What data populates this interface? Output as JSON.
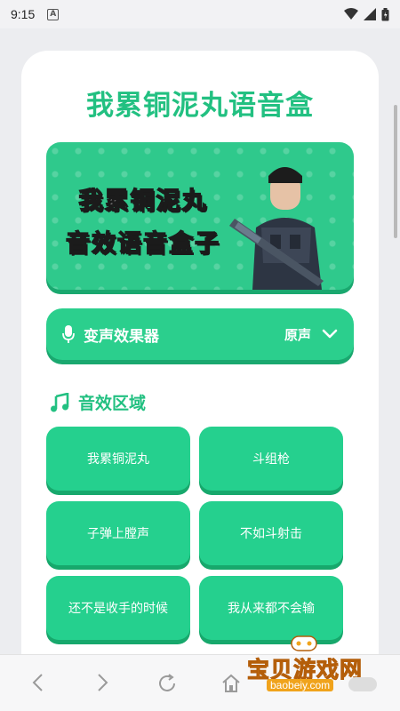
{
  "status_bar": {
    "time": "9:15",
    "app_icon_letter": "A"
  },
  "app": {
    "title": "我累铜泥丸语音盒"
  },
  "banner": {
    "line1": "我累铜泥丸",
    "line2": "音效语音盒子"
  },
  "voice_changer": {
    "label": "变声效果器",
    "selected": "原声"
  },
  "sound_section": {
    "title": "音效区域",
    "items": [
      {
        "label": "我累铜泥丸"
      },
      {
        "label": "斗组枪"
      },
      {
        "label": "子弹上膛声"
      },
      {
        "label": "不如斗射击"
      },
      {
        "label": "还不是收手的时候"
      },
      {
        "label": "我从来都不会输"
      }
    ]
  },
  "watermark": {
    "text": "宝贝游戏网",
    "url": "baobeiy.com"
  },
  "colors": {
    "accent": "#22c081",
    "button": "#25d08e",
    "button_shadow": "#17a86c"
  },
  "icons": [
    "mic-icon",
    "chevron-down-icon",
    "music-note-icon",
    "back-icon",
    "forward-icon",
    "refresh-icon",
    "home-icon",
    "wifi-icon",
    "signal-icon",
    "battery-icon"
  ]
}
